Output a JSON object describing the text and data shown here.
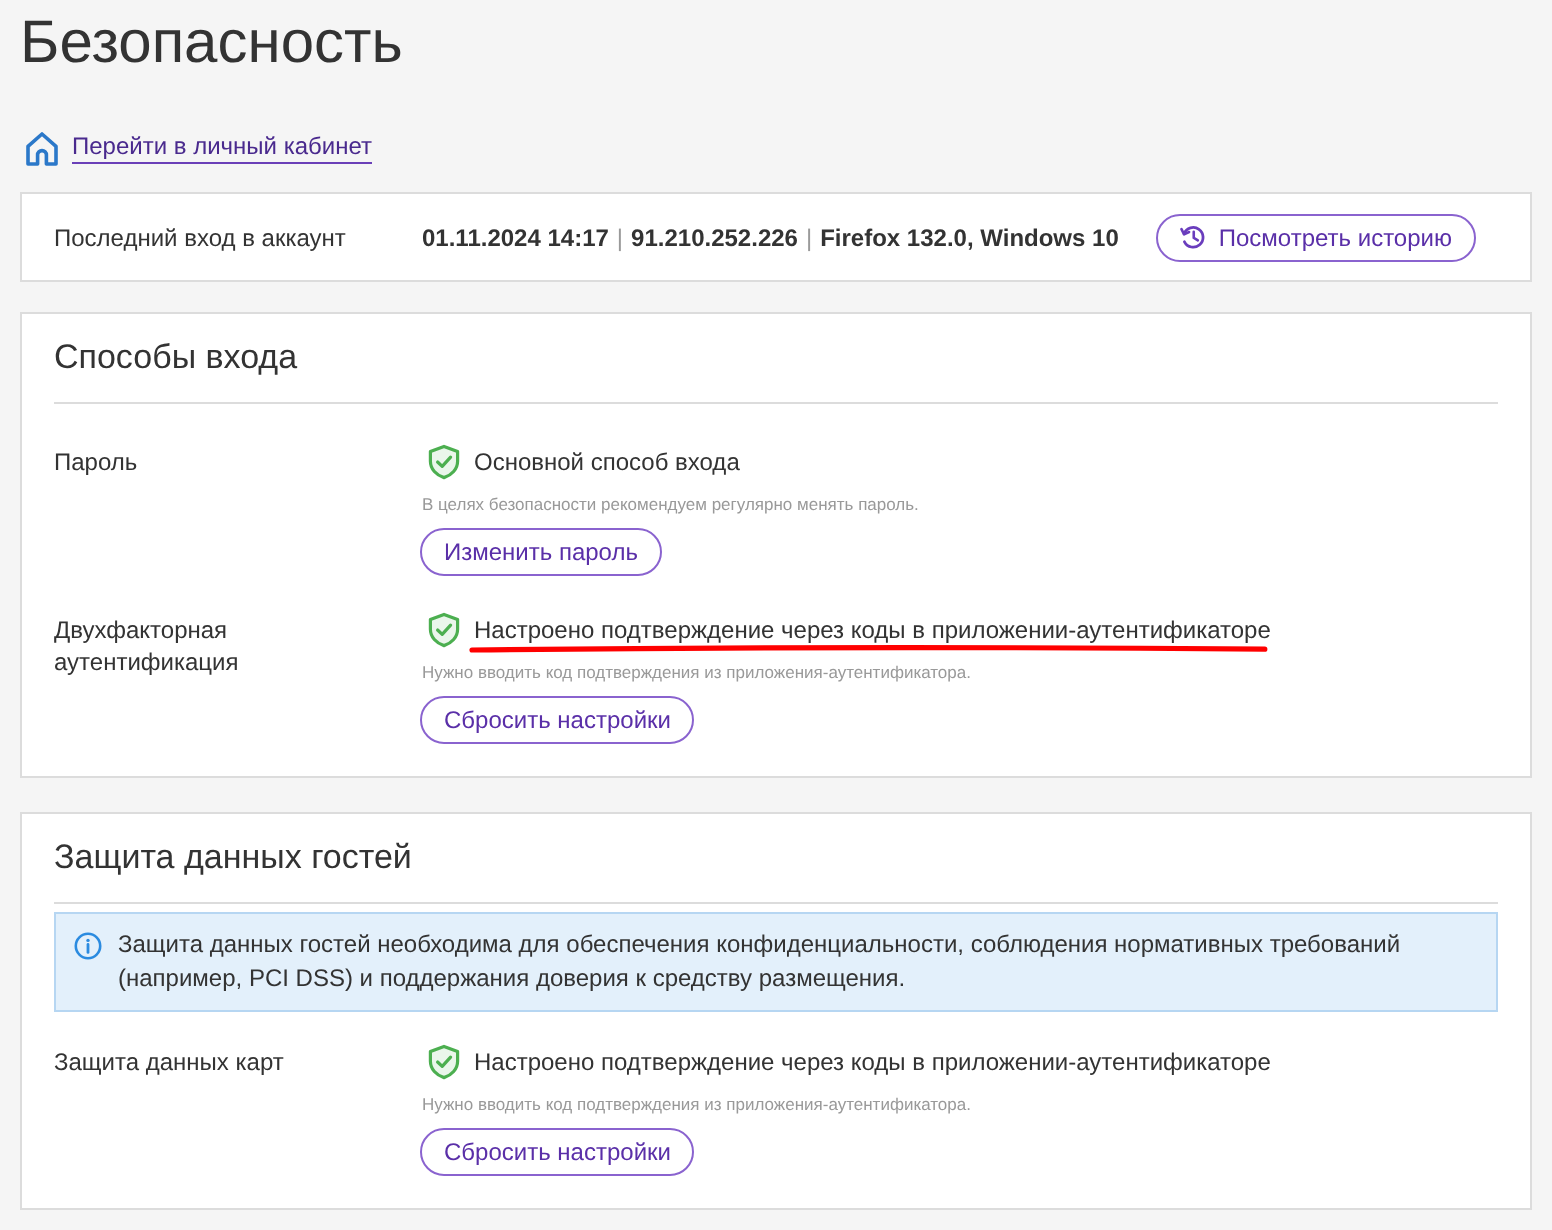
{
  "header": {
    "title": "Безопасность",
    "account_link": "Перейти в личный кабинет"
  },
  "last_login": {
    "label": "Последний вход в аккаунт",
    "details": [
      {
        "kind": "value",
        "text": "01.11.2024 14:17"
      },
      {
        "kind": "separator",
        "text": "|"
      },
      {
        "kind": "value",
        "text": "91.210.252.226"
      },
      {
        "kind": "separator",
        "text": "|"
      },
      {
        "kind": "value",
        "text": "Firefox 132.0, Windows 10"
      }
    ],
    "button": "Посмотреть историю"
  },
  "sections": [
    {
      "title": "Способы входа",
      "rows": [
        {
          "label": "Пароль",
          "status": "Основной способ входа",
          "hint": "В целях безопасности рекомендуем регулярно менять пароль.",
          "button": "Изменить пароль",
          "underlined": false
        },
        {
          "label": "Двухфакторная аутентификация",
          "status": "Настроено подтверждение через коды в приложении-аутентификаторе",
          "hint": "Нужно вводить код подтверждения из приложения-аутентификатора.",
          "button": "Сбросить настройки",
          "underlined": true
        }
      ]
    },
    {
      "title": "Защита данных гостей",
      "notice": "Защита данных гостей необходима для обеспечения конфиденциальности, соблюдения нормативных требований (например, PCI DSS) и поддержания доверия к средству размещения.",
      "rows": [
        {
          "label": "Защита данных карт",
          "status": "Настроено подтверждение через коды в приложении-аутентификаторе",
          "hint": "Нужно вводить код подтверждения из приложения-аутентификатора.",
          "button": "Сбросить настройки",
          "underlined": false
        }
      ]
    }
  ]
}
